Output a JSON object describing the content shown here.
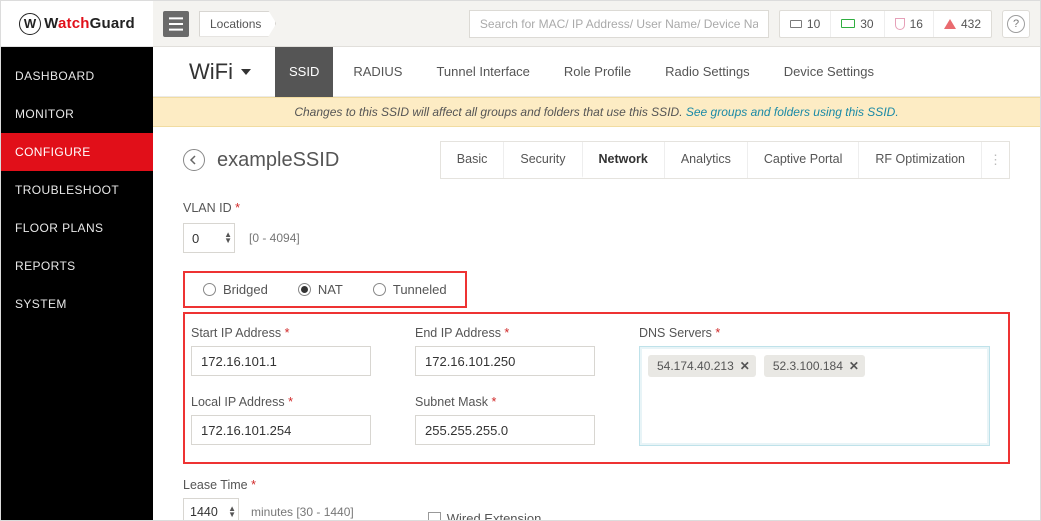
{
  "logo": {
    "brand_a": "W",
    "brand_b": "atch",
    "brand_c": "G",
    "brand_d": "uard"
  },
  "nav": {
    "items": [
      {
        "label": "DASHBOARD"
      },
      {
        "label": "MONITOR"
      },
      {
        "label": "CONFIGURE"
      },
      {
        "label": "TROUBLESHOOT"
      },
      {
        "label": "FLOOR PLANS"
      },
      {
        "label": "REPORTS"
      },
      {
        "label": "SYSTEM"
      }
    ]
  },
  "topbar": {
    "breadcrumb": "Locations",
    "search_placeholder": "Search for MAC/ IP Address/ User Name/ Device Name.",
    "stats": {
      "aps": "10",
      "clients": "30",
      "shield": "16",
      "alerts": "432"
    },
    "help": "?"
  },
  "wifibar": {
    "title": "WiFi",
    "tabs": [
      {
        "label": "SSID"
      },
      {
        "label": "RADIUS"
      },
      {
        "label": "Tunnel Interface"
      },
      {
        "label": "Role Profile"
      },
      {
        "label": "Radio Settings"
      },
      {
        "label": "Device Settings"
      }
    ]
  },
  "banner": {
    "text": "Changes to this SSID will affect all groups and folders that use this SSID. ",
    "link": "See groups and folders using this SSID."
  },
  "page": {
    "title": "exampleSSID",
    "tabs": [
      {
        "label": "Basic"
      },
      {
        "label": "Security"
      },
      {
        "label": "Network"
      },
      {
        "label": "Analytics"
      },
      {
        "label": "Captive Portal"
      },
      {
        "label": "RF Optimization"
      }
    ]
  },
  "form": {
    "vlan_label": "VLAN ID",
    "vlan_value": "0",
    "vlan_hint": "[0 - 4094]",
    "modes": {
      "bridged": "Bridged",
      "nat": "NAT",
      "tunneled": "Tunneled"
    },
    "start_ip_label": "Start IP Address",
    "start_ip": "172.16.101.1",
    "end_ip_label": "End IP Address",
    "end_ip": "172.16.101.250",
    "dns_label": "DNS Servers",
    "dns": [
      "54.174.40.213",
      "52.3.100.184"
    ],
    "local_ip_label": "Local IP Address",
    "local_ip": "172.16.101.254",
    "subnet_label": "Subnet Mask",
    "subnet": "255.255.255.0",
    "lease_label": "Lease Time",
    "lease_value": "1440",
    "lease_hint": "minutes [30 - 1440]",
    "wired_label": "Wired Extension"
  }
}
